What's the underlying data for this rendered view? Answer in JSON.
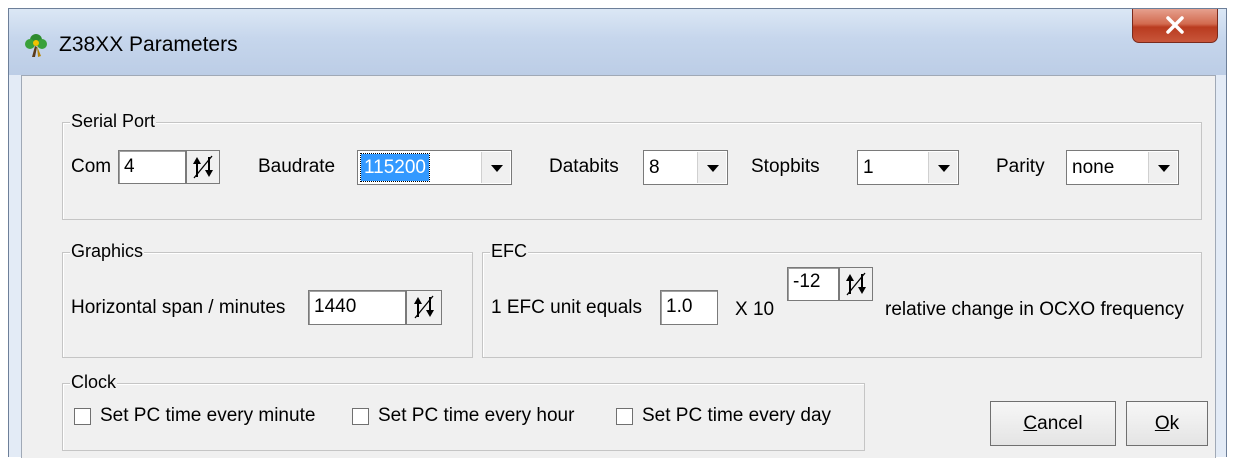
{
  "window": {
    "title": "Z38XX Parameters",
    "app_icon": "app-flower-icon",
    "close_icon": "close-x-icon"
  },
  "serial_port": {
    "group_label": "Serial Port",
    "com_label": "Com",
    "com_value": "4",
    "baudrate_label": "Baudrate",
    "baudrate_value": "115200",
    "databits_label": "Databits",
    "databits_value": "8",
    "stopbits_label": "Stopbits",
    "stopbits_value": "1",
    "parity_label": "Parity",
    "parity_value": "none"
  },
  "graphics": {
    "group_label": "Graphics",
    "span_label": "Horizontal span / minutes",
    "span_value": "1440"
  },
  "efc": {
    "group_label": "EFC",
    "unit_label": "1 EFC unit equals",
    "unit_value": "1.0",
    "times_label": "X 10",
    "exponent_value": "-12",
    "suffix_label": "relative change in OCXO frequency"
  },
  "clock": {
    "group_label": "Clock",
    "options": [
      {
        "label": "Set PC time every minute",
        "checked": false
      },
      {
        "label": "Set PC time every hour",
        "checked": false
      },
      {
        "label": "Set PC time every day",
        "checked": false
      }
    ]
  },
  "buttons": {
    "cancel_mnemonic": "C",
    "cancel_rest": "ancel",
    "ok_mnemonic": "O",
    "ok_rest": "k"
  },
  "colors": {
    "selection": "#3399ff",
    "close_button": "#c8563b",
    "dialog_face": "#f0f0f0"
  }
}
